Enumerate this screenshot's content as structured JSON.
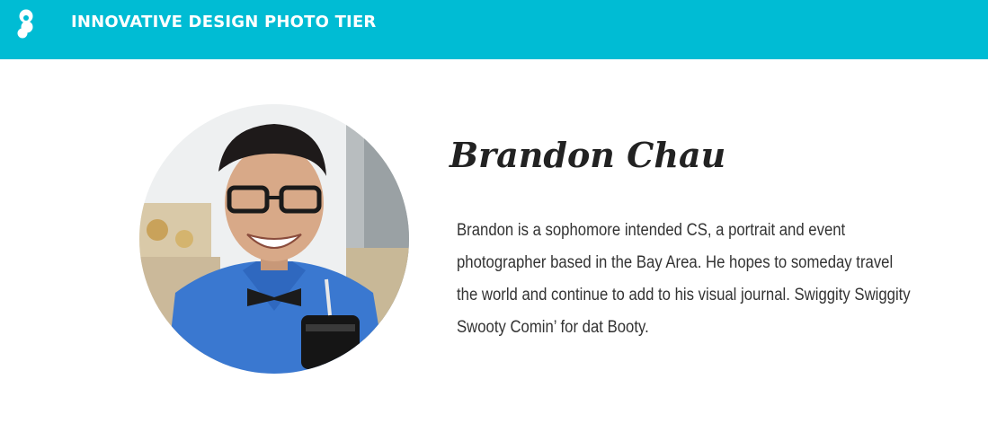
{
  "header": {
    "title": "INNOVATIVE DESIGN PHOTO TIER",
    "logo_icon": "innovative-design-logo-icon"
  },
  "profile": {
    "name": "Brandon Chau",
    "bio": "Brandon is a sophomore intended CS, a portrait and event photographer based in the Bay Area. He hopes to someday travel the world and continue to add to his visual journal. Swiggity Swiggity Swooty Comin’ for dat Booty."
  },
  "colors": {
    "accent": "#00bcd4",
    "text": "#333333"
  }
}
